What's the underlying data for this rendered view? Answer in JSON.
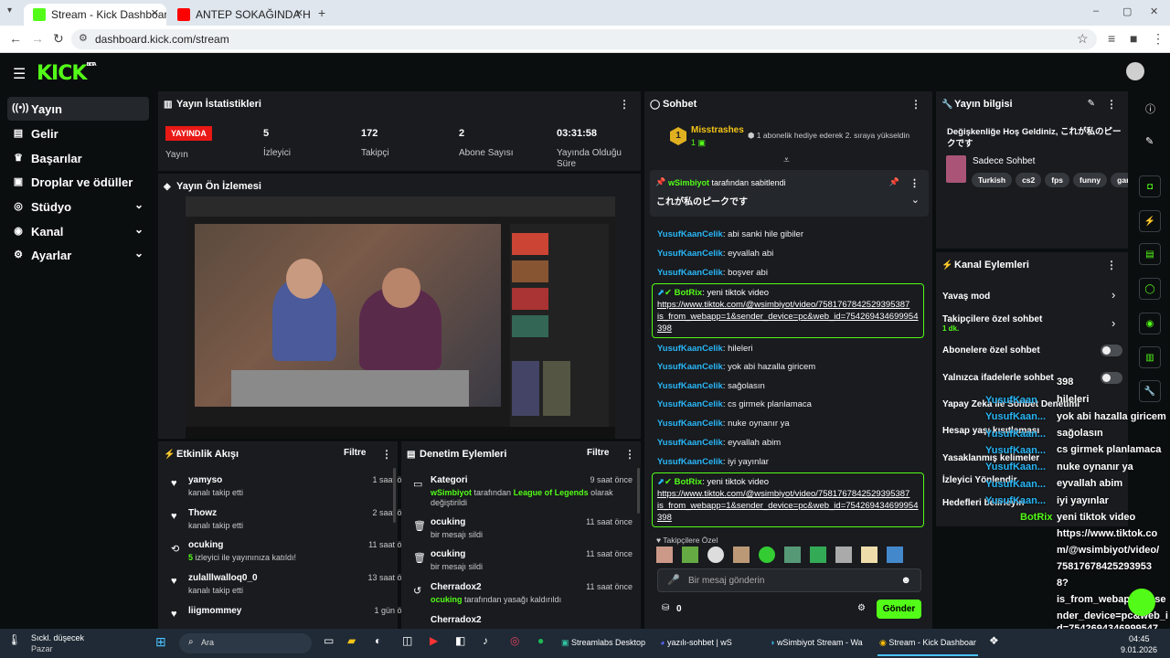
{
  "browser": {
    "tabs": [
      {
        "title": "Stream - Kick Dashboard"
      },
      {
        "title": "ANTEP SOKAĞINDA HER ŞEYİ Y"
      }
    ],
    "url": "dashboard.kick.com/stream"
  },
  "header": {
    "logo": "KICK",
    "logo_badge": "BETA"
  },
  "sidebar": {
    "items": [
      {
        "label": "Yayın",
        "icon": "broadcast-icon"
      },
      {
        "label": "Gelir",
        "icon": "revenue-icon"
      },
      {
        "label": "Başarılar",
        "icon": "trophy-icon"
      },
      {
        "label": "Droplar ve ödüller",
        "icon": "gift-icon"
      },
      {
        "label": "Stüdyo",
        "icon": "studio-icon"
      },
      {
        "label": "Kanal",
        "icon": "channel-icon"
      },
      {
        "label": "Ayarlar",
        "icon": "gear-icon"
      }
    ]
  },
  "stats": {
    "title": "Yayın İstatistikleri",
    "live_badge": "YAYINDA",
    "live_label": "Yayın",
    "items": [
      {
        "value": "5",
        "label": "İzleyici"
      },
      {
        "value": "172",
        "label": "Takipçi"
      },
      {
        "value": "2",
        "label": "Abone Sayısı"
      },
      {
        "value": "03:31:58",
        "label": "Yayında Olduğu Süre"
      }
    ]
  },
  "preview": {
    "title": "Yayın Ön İzlemesi"
  },
  "activity": {
    "title": "Etkinlik Akışı",
    "filter": "Filtre",
    "items": [
      {
        "name": "yamyso",
        "sub": "kanalı takip etti",
        "time": "1 saat önce"
      },
      {
        "name": "Thowz",
        "sub": "kanalı takip etti",
        "time": "2 saat önce"
      },
      {
        "name": "ocuking",
        "sub_count": "5",
        "sub": " izleyici ile yayınınıza katıldı!",
        "time": "11 saat önce"
      },
      {
        "name": "zulalllwalloq0_0",
        "sub": "kanalı takip etti",
        "time": "13 saat önce"
      },
      {
        "name": "liigmommey",
        "sub": "",
        "time": "1 gün önce"
      }
    ]
  },
  "moderation": {
    "title": "Denetim Eylemleri",
    "filter": "Filtre",
    "items": [
      {
        "name": "Kategori",
        "actor": "wSimbiyot",
        "mid": " tarafından ",
        "target": "League of Legends",
        "rest": " olarak değiştirildi",
        "time": "9 saat önce"
      },
      {
        "name": "ocuking",
        "sub": "bir mesajı sildi",
        "time": "11 saat önce"
      },
      {
        "name": "ocuking",
        "sub": "bir mesajı sildi",
        "time": "11 saat önce"
      },
      {
        "name": "Cherradox2",
        "actor": "ocuking",
        "rest": " tarafından yasağı kaldırıldı",
        "time": "11 saat önce"
      },
      {
        "name": "Cherradox2",
        "time": ""
      }
    ]
  },
  "chat": {
    "title": "Sohbet",
    "top_user": "Misstrashes",
    "top_rank": "1",
    "gift_text": "1 abonelik hediye ederek 2. sıraya yükseldin",
    "pinned_by": "wSimbiyot",
    "pinned_suffix": " tarafından sabitlendi",
    "pinned_text": "これが私のピークです",
    "messages": [
      {
        "user": "YusufKaanCelik",
        "text": "abi sanki hile gibiler"
      },
      {
        "user": "YusufKaanCelik",
        "text": "eyvallah abi"
      },
      {
        "user": "YusufKaanCelik",
        "text": "boşver abi"
      },
      {
        "user": "YusufKaanCelik",
        "text": "hileleri"
      },
      {
        "user": "YusufKaanCelik",
        "text": "yok abi hazalla giricem"
      },
      {
        "user": "YusufKaanCelik",
        "text": "sağolasın"
      },
      {
        "user": "YusufKaanCelik",
        "text": "cs girmek planlamaca"
      },
      {
        "user": "YusufKaanCelik",
        "text": "nuke oynanır ya"
      },
      {
        "user": "YusufKaanCelik",
        "text": "eyvallah abim"
      },
      {
        "user": "YusufKaanCelik",
        "text": "iyi yayınlar"
      }
    ],
    "bot": {
      "user": "BotRix",
      "text": "yeni tiktok video",
      "link1": "https://www.tiktok.com/@wsimbiyot/video/7581767842529395387",
      "link2": "is_from_webapp=1&sender_device=pc&web_id=754269434699954",
      "link3": "398"
    },
    "followers_label": "Takipçilere Özel",
    "input_placeholder": "Bir mesaj gönderin",
    "points": "0",
    "send": "Gönder"
  },
  "info": {
    "title": "Yayın bilgisi",
    "stream_title": "Değişkenliğe Hoş Geldiniz, これが私のピークです",
    "category": "Sadece Sohbet",
    "tags": [
      "Turkish",
      "cs2",
      "fps",
      "funny",
      "gam"
    ]
  },
  "channel_actions": {
    "title": "Kanal Eylemleri",
    "items": [
      {
        "label": "Yavaş mod"
      },
      {
        "label": "Takipçilere özel sohbet",
        "sub": "1 dk."
      },
      {
        "label": "Abonelere özel sohbet"
      },
      {
        "label": "Yalnızca ifadelerle sohbet"
      },
      {
        "label": "Yapay Zeka ile Sohbet Denetimi"
      },
      {
        "label": "Hesap yaşı kısıtlaması"
      },
      {
        "label": "Yasaklanmış kelimeler"
      },
      {
        "label": "İzleyici Yönlendir"
      },
      {
        "label": "Hedefleri belirleyin"
      }
    ]
  },
  "overlay": {
    "lines": [
      "398",
      "hileleri",
      "yok abi hazalla giricem",
      "sağolasın",
      "cs girmek planlamaca",
      "nuke oynanır ya",
      "eyvallah abim",
      "iyi yayınlar",
      "yeni tiktok video",
      "https://www.tiktok.co",
      "m/@wsimbiyot/video/",
      "75817678425293953",
      "8?",
      "is_from_webapp=1&se",
      "nder_device=pc&web_i",
      "d=7542694346999547",
      "398"
    ],
    "users": [
      "YusufKaan",
      "YusufKaan...",
      "YusufKaan...",
      "YusufKaan...",
      "YusufKaan...",
      "YusufKaan...",
      "YusufKaan..."
    ],
    "bot": "BotRix"
  },
  "taskbar": {
    "weather": "Sıckl. düşecek",
    "weather_sub": "Pazar",
    "search": "Ara",
    "apps": [
      "Streamlabs Desktop",
      "yazılı-sohbet | wS",
      "wSimbiyot Stream - Wa",
      "Stream - Kick Dashboar"
    ],
    "time": "04:45",
    "date": "9.01.2026"
  },
  "colors": {
    "accent": "#53fc18",
    "panel": "#191b1f",
    "bg": "#0b0e0f",
    "live": "#e91916",
    "chat_user": "#29b6f6"
  }
}
